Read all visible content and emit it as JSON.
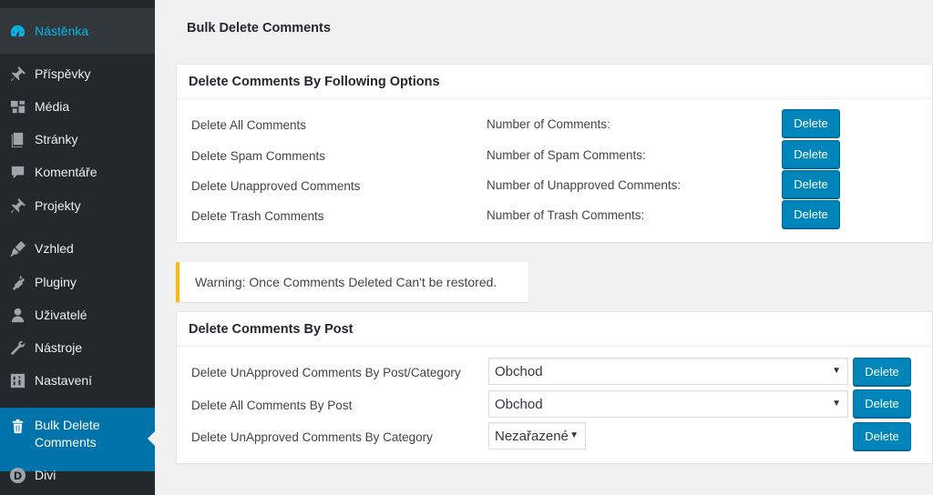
{
  "sidebar": {
    "items": [
      {
        "label": "Nástěnka",
        "icon": "dashboard-icon"
      },
      {
        "label": "Příspěvky",
        "icon": "pin-icon"
      },
      {
        "label": "Média",
        "icon": "media-icon"
      },
      {
        "label": "Stránky",
        "icon": "pages-icon"
      },
      {
        "label": "Komentáře",
        "icon": "comments-icon"
      },
      {
        "label": "Projekty",
        "icon": "pin-icon"
      },
      {
        "label": "Vzhled",
        "icon": "appearance-icon"
      },
      {
        "label": "Pluginy",
        "icon": "plugin-icon"
      },
      {
        "label": "Uživatelé",
        "icon": "user-icon"
      },
      {
        "label": "Nástroje",
        "icon": "wrench-icon"
      },
      {
        "label": "Nastavení",
        "icon": "settings-icon"
      },
      {
        "label": "Bulk Delete Comments",
        "icon": "trash-icon"
      },
      {
        "label": "Divi",
        "icon": "divi-icon"
      }
    ]
  },
  "page": {
    "title": "Bulk Delete Comments"
  },
  "options_panel": {
    "title": "Delete Comments By Following Options",
    "rows": [
      {
        "label": "Delete All Comments",
        "count_label": "Number of Comments:",
        "button": "Delete"
      },
      {
        "label": "Delete Spam Comments",
        "count_label": "Number of Spam Comments:",
        "button": "Delete"
      },
      {
        "label": "Delete Unapproved Comments",
        "count_label": "Number of Unapproved Comments:",
        "button": "Delete"
      },
      {
        "label": "Delete Trash Comments",
        "count_label": "Number of Trash Comments:",
        "button": "Delete"
      }
    ]
  },
  "warning": {
    "text": "Warning: Once Comments Deleted Can't be restored."
  },
  "post_panel": {
    "title": "Delete Comments By Post",
    "rows": [
      {
        "label": "Delete UnApproved Comments By Post/Category",
        "selected": "Obchod",
        "button": "Delete"
      },
      {
        "label": "Delete All Comments By Post",
        "selected": "Obchod",
        "button": "Delete"
      },
      {
        "label": "Delete UnApproved Comments By Category",
        "selected": "Nezařazené",
        "button": "Delete"
      }
    ]
  },
  "colors": {
    "sidebar_bg": "#23282d",
    "accent": "#0073aa",
    "button": "#0085ba",
    "warning": "#ffb900",
    "active_link": "#00b9eb"
  }
}
